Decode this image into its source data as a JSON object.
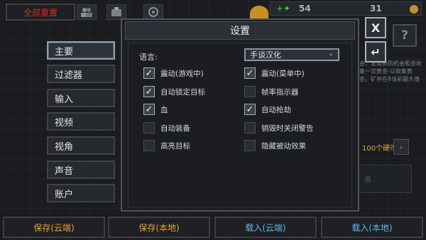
{
  "topbar": {
    "reset_label": "全部重置",
    "gem_value": "54",
    "coin_value": "31"
  },
  "tabs": [
    {
      "label": "主要",
      "active": true
    },
    {
      "label": "过滤器"
    },
    {
      "label": "输入"
    },
    {
      "label": "视频"
    },
    {
      "label": "视角"
    },
    {
      "label": "声音"
    },
    {
      "label": "账户"
    }
  ],
  "modal": {
    "title": "设置",
    "close_label": "X",
    "back_label": "↵",
    "help_label": "?",
    "language_label": "语言:",
    "language_value": "手谈汉化",
    "options_left": [
      {
        "label": "震动(游戏中)",
        "checked": true
      },
      {
        "label": "自动锁定目标",
        "checked": true
      },
      {
        "label": "血",
        "checked": true
      },
      {
        "label": "自动装备",
        "checked": false
      },
      {
        "label": "高亮目标",
        "checked": false
      }
    ],
    "options_right": [
      {
        "label": "震动(菜单中)",
        "checked": true
      },
      {
        "label": "帧率指示器",
        "checked": false
      },
      {
        "label": "自动抢劫",
        "checked": true
      },
      {
        "label": "销毁时关闭警告",
        "checked": false
      },
      {
        "label": "隐藏被动效果",
        "checked": false
      }
    ]
  },
  "side_info": {
    "text": "会，发现新的机会和金收集一次黄金-以收集黄金。矿井在8当前最大值",
    "coin_badge": "100个硬币",
    "coin_badge_arrow": "›",
    "panel_text": "币"
  },
  "bottom": [
    {
      "label": "保存(云端)",
      "color": "gold"
    },
    {
      "label": "保存(本地)",
      "color": "gold"
    },
    {
      "label": "载入(云端)",
      "color": "blue"
    },
    {
      "label": "载入(本地)",
      "color": "blue"
    }
  ],
  "colors": {
    "reset": "#e0242a",
    "gold": "#e8a23a",
    "blue": "#5fb6e6",
    "gem": "#4fc34a"
  }
}
